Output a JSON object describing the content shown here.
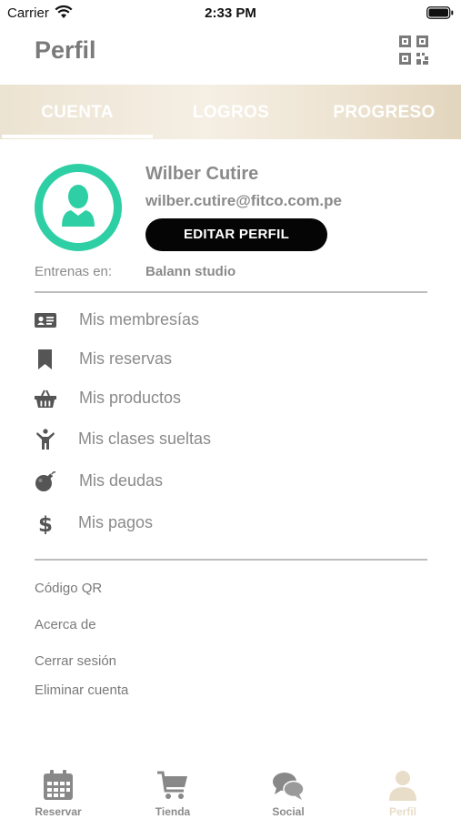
{
  "status_bar": {
    "carrier": "Carrier",
    "time": "2:33 PM"
  },
  "header": {
    "title": "Perfil",
    "qr_icon": "qr-code-icon"
  },
  "tabs": [
    {
      "label": "CUENTA",
      "active": true
    },
    {
      "label": "LOGROS",
      "active": false
    },
    {
      "label": "PROGRESO",
      "active": false
    }
  ],
  "profile": {
    "name": "Wilber Cutire",
    "email": "wilber.cutire@fitco.com.pe",
    "edit_button": "EDITAR PERFIL",
    "gym_label": "Entrenas en:",
    "gym_value": "Balann studio"
  },
  "menu": [
    {
      "label": "Mis membresías",
      "icon": "id-card-icon"
    },
    {
      "label": "Mis reservas",
      "icon": "bookmark-icon"
    },
    {
      "label": "Mis productos",
      "icon": "basket-icon"
    },
    {
      "label": "Mis clases sueltas",
      "icon": "person-icon"
    },
    {
      "label": "Mis deudas",
      "icon": "bomb-icon"
    },
    {
      "label": "Mis pagos",
      "icon": "dollar-icon"
    }
  ],
  "links": [
    "Código QR",
    "Acerca de",
    "Cerrar sesión",
    "Eliminar cuenta"
  ],
  "bottom_nav": [
    {
      "label": "Reservar",
      "icon": "calendar-icon",
      "active": false
    },
    {
      "label": "Tienda",
      "icon": "cart-icon",
      "active": false
    },
    {
      "label": "Social",
      "icon": "chat-bubbles-icon",
      "active": false
    },
    {
      "label": "Perfil",
      "icon": "user-icon",
      "active": true
    }
  ],
  "colors": {
    "accent": "#2ecfa4",
    "tab_bg": "#ece3d2",
    "button": "#050505",
    "active_nav": "#e8ddc8",
    "text_muted": "#8a8a8a"
  }
}
